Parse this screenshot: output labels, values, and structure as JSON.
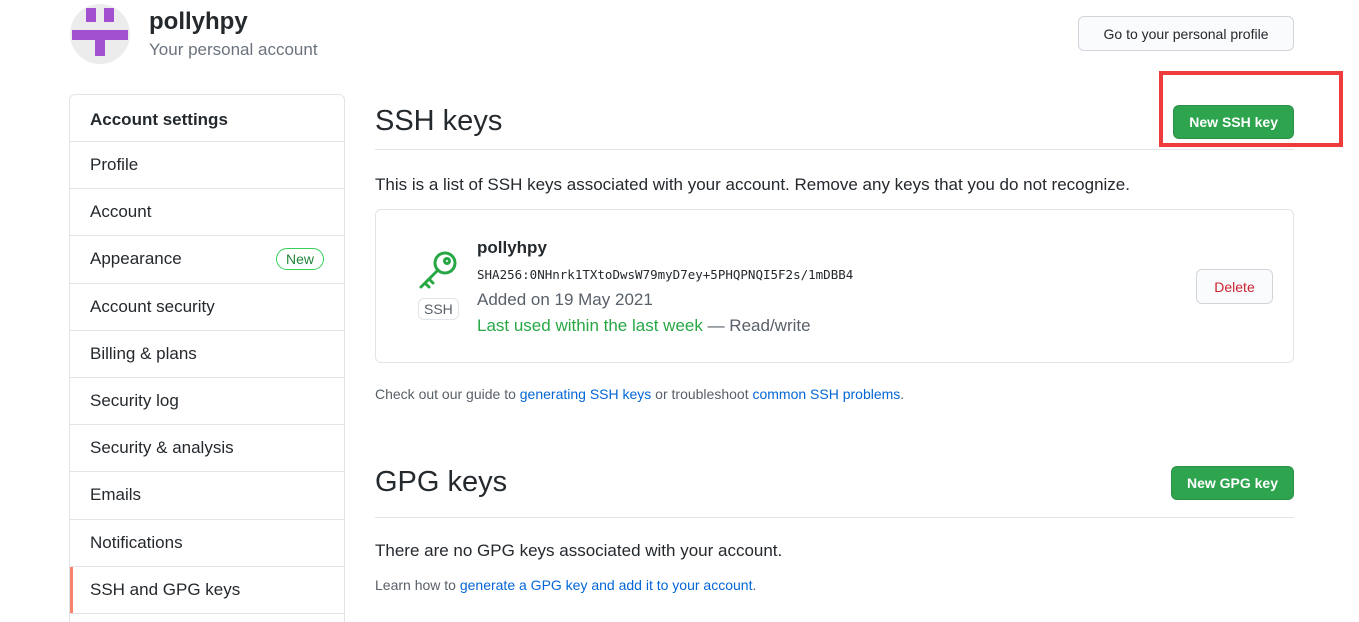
{
  "header": {
    "username": "pollyhpy",
    "subtitle": "Your personal account",
    "profile_button": "Go to your personal profile"
  },
  "sidebar": {
    "heading": "Account settings",
    "items": [
      {
        "label": "Profile"
      },
      {
        "label": "Account"
      },
      {
        "label": "Appearance",
        "badge": "New"
      },
      {
        "label": "Account security"
      },
      {
        "label": "Billing & plans"
      },
      {
        "label": "Security log"
      },
      {
        "label": "Security & analysis"
      },
      {
        "label": "Emails"
      },
      {
        "label": "Notifications"
      },
      {
        "label": "SSH and GPG keys",
        "selected": true
      }
    ]
  },
  "ssh": {
    "title": "SSH keys",
    "new_button": "New SSH key",
    "description": "This is a list of SSH keys associated with your account. Remove any keys that you do not recognize.",
    "key": {
      "icon": "key-icon",
      "type_label": "SSH",
      "name": "pollyhpy",
      "fingerprint": "SHA256:0NHnrk1TXtoDwsW79myD7ey+5PHQPNQI5F2s/1mDBB4",
      "added": "Added on 19 May 2021",
      "last_used": "Last used within the last week",
      "access": " — Read/write",
      "delete_button": "Delete"
    },
    "guide": {
      "prefix": "Check out our guide to ",
      "link1": "generating SSH keys",
      "middle": " or troubleshoot ",
      "link2": "common SSH problems",
      "suffix": "."
    }
  },
  "gpg": {
    "title": "GPG keys",
    "new_button": "New GPG key",
    "empty": "There are no GPG keys associated with your account.",
    "learn": {
      "prefix": "Learn how to ",
      "link": "generate a GPG key and add it to your account",
      "suffix": "."
    }
  },
  "colors": {
    "green": "#2ea44f",
    "highlight": "#ee3b3b",
    "link": "#0366d6",
    "selected_marker": "#f9826c"
  }
}
